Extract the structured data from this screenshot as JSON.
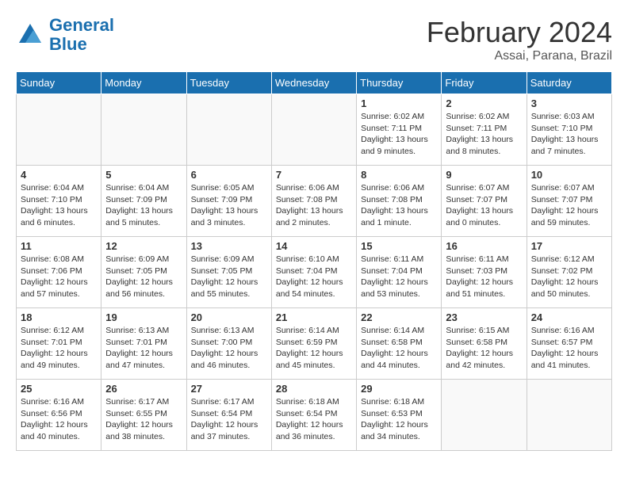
{
  "header": {
    "logo_general": "General",
    "logo_blue": "Blue",
    "month_year": "February 2024",
    "location": "Assai, Parana, Brazil"
  },
  "weekdays": [
    "Sunday",
    "Monday",
    "Tuesday",
    "Wednesday",
    "Thursday",
    "Friday",
    "Saturday"
  ],
  "weeks": [
    [
      {
        "day": "",
        "info": ""
      },
      {
        "day": "",
        "info": ""
      },
      {
        "day": "",
        "info": ""
      },
      {
        "day": "",
        "info": ""
      },
      {
        "day": "1",
        "info": "Sunrise: 6:02 AM\nSunset: 7:11 PM\nDaylight: 13 hours\nand 9 minutes."
      },
      {
        "day": "2",
        "info": "Sunrise: 6:02 AM\nSunset: 7:11 PM\nDaylight: 13 hours\nand 8 minutes."
      },
      {
        "day": "3",
        "info": "Sunrise: 6:03 AM\nSunset: 7:10 PM\nDaylight: 13 hours\nand 7 minutes."
      }
    ],
    [
      {
        "day": "4",
        "info": "Sunrise: 6:04 AM\nSunset: 7:10 PM\nDaylight: 13 hours\nand 6 minutes."
      },
      {
        "day": "5",
        "info": "Sunrise: 6:04 AM\nSunset: 7:09 PM\nDaylight: 13 hours\nand 5 minutes."
      },
      {
        "day": "6",
        "info": "Sunrise: 6:05 AM\nSunset: 7:09 PM\nDaylight: 13 hours\nand 3 minutes."
      },
      {
        "day": "7",
        "info": "Sunrise: 6:06 AM\nSunset: 7:08 PM\nDaylight: 13 hours\nand 2 minutes."
      },
      {
        "day": "8",
        "info": "Sunrise: 6:06 AM\nSunset: 7:08 PM\nDaylight: 13 hours\nand 1 minute."
      },
      {
        "day": "9",
        "info": "Sunrise: 6:07 AM\nSunset: 7:07 PM\nDaylight: 13 hours\nand 0 minutes."
      },
      {
        "day": "10",
        "info": "Sunrise: 6:07 AM\nSunset: 7:07 PM\nDaylight: 12 hours\nand 59 minutes."
      }
    ],
    [
      {
        "day": "11",
        "info": "Sunrise: 6:08 AM\nSunset: 7:06 PM\nDaylight: 12 hours\nand 57 minutes."
      },
      {
        "day": "12",
        "info": "Sunrise: 6:09 AM\nSunset: 7:05 PM\nDaylight: 12 hours\nand 56 minutes."
      },
      {
        "day": "13",
        "info": "Sunrise: 6:09 AM\nSunset: 7:05 PM\nDaylight: 12 hours\nand 55 minutes."
      },
      {
        "day": "14",
        "info": "Sunrise: 6:10 AM\nSunset: 7:04 PM\nDaylight: 12 hours\nand 54 minutes."
      },
      {
        "day": "15",
        "info": "Sunrise: 6:11 AM\nSunset: 7:04 PM\nDaylight: 12 hours\nand 53 minutes."
      },
      {
        "day": "16",
        "info": "Sunrise: 6:11 AM\nSunset: 7:03 PM\nDaylight: 12 hours\nand 51 minutes."
      },
      {
        "day": "17",
        "info": "Sunrise: 6:12 AM\nSunset: 7:02 PM\nDaylight: 12 hours\nand 50 minutes."
      }
    ],
    [
      {
        "day": "18",
        "info": "Sunrise: 6:12 AM\nSunset: 7:01 PM\nDaylight: 12 hours\nand 49 minutes."
      },
      {
        "day": "19",
        "info": "Sunrise: 6:13 AM\nSunset: 7:01 PM\nDaylight: 12 hours\nand 47 minutes."
      },
      {
        "day": "20",
        "info": "Sunrise: 6:13 AM\nSunset: 7:00 PM\nDaylight: 12 hours\nand 46 minutes."
      },
      {
        "day": "21",
        "info": "Sunrise: 6:14 AM\nSunset: 6:59 PM\nDaylight: 12 hours\nand 45 minutes."
      },
      {
        "day": "22",
        "info": "Sunrise: 6:14 AM\nSunset: 6:58 PM\nDaylight: 12 hours\nand 44 minutes."
      },
      {
        "day": "23",
        "info": "Sunrise: 6:15 AM\nSunset: 6:58 PM\nDaylight: 12 hours\nand 42 minutes."
      },
      {
        "day": "24",
        "info": "Sunrise: 6:16 AM\nSunset: 6:57 PM\nDaylight: 12 hours\nand 41 minutes."
      }
    ],
    [
      {
        "day": "25",
        "info": "Sunrise: 6:16 AM\nSunset: 6:56 PM\nDaylight: 12 hours\nand 40 minutes."
      },
      {
        "day": "26",
        "info": "Sunrise: 6:17 AM\nSunset: 6:55 PM\nDaylight: 12 hours\nand 38 minutes."
      },
      {
        "day": "27",
        "info": "Sunrise: 6:17 AM\nSunset: 6:54 PM\nDaylight: 12 hours\nand 37 minutes."
      },
      {
        "day": "28",
        "info": "Sunrise: 6:18 AM\nSunset: 6:54 PM\nDaylight: 12 hours\nand 36 minutes."
      },
      {
        "day": "29",
        "info": "Sunrise: 6:18 AM\nSunset: 6:53 PM\nDaylight: 12 hours\nand 34 minutes."
      },
      {
        "day": "",
        "info": ""
      },
      {
        "day": "",
        "info": ""
      }
    ]
  ]
}
